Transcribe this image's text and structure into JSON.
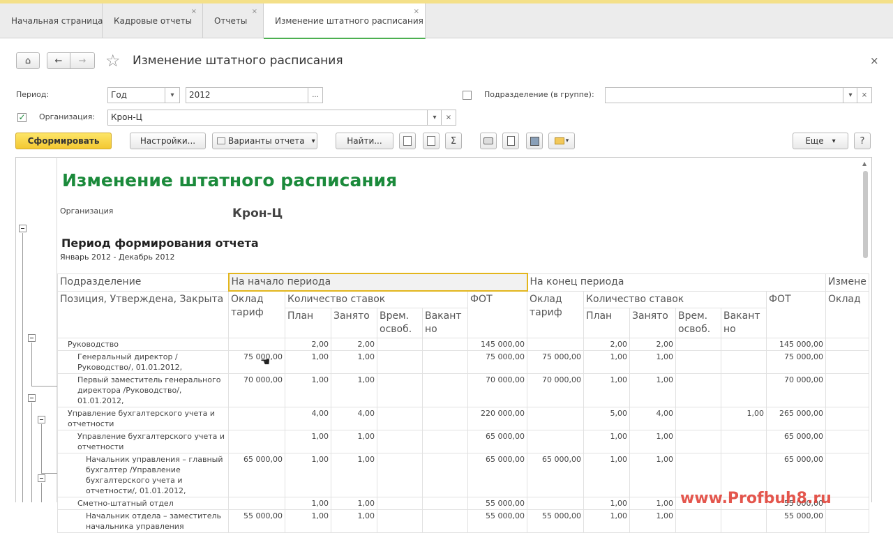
{
  "tabs": [
    {
      "label": "Начальная страница",
      "close": ""
    },
    {
      "label": "Кадровые отчеты",
      "close": "×"
    },
    {
      "label": "Отчеты",
      "close": "×"
    },
    {
      "label": "Изменение штатного расписания",
      "close": "×"
    }
  ],
  "window": {
    "title": "Изменение штатного расписания",
    "close": "×",
    "home_icon": "⌂",
    "back_icon": "←",
    "forward_icon": "→",
    "favorite_icon": "☆"
  },
  "form": {
    "period_label": "Период:",
    "period_type": "Год",
    "period_value": "2012",
    "period_select": "...",
    "subdivision_label": "Подразделение (в группе):",
    "subdivision_value": "",
    "org_label": "Организация:",
    "org_value": "Крон-Ц",
    "org_checked": "✓",
    "dropdown": "▾",
    "clear": "×"
  },
  "toolbar": {
    "generate": "Сформировать",
    "settings": "Настройки...",
    "variants": "Варианты отчета",
    "find": "Найти...",
    "sum_icon": "Σ",
    "more": "Еще",
    "help": "?"
  },
  "report": {
    "title": "Изменение штатного расписания",
    "org_label": "Организация",
    "org_value": "Крон-Ц",
    "period_header": "Период формирования отчета",
    "period_value": "Январь 2012 - Декабрь 2012",
    "col_subdivision": "Подразделение",
    "col_position": "Позиция, Утверждена, Закрыта",
    "group_start": "На начало периода",
    "group_end": "На конец периода",
    "group_change": "Измене",
    "salary": "Оклад тариф",
    "salary_cut": "Оклад",
    "rates": "Количество ставок",
    "plan": "План",
    "occupied": "Занято",
    "temp_free": "Врем. освоб.",
    "vacant": "Вакант но",
    "fot": "ФОТ",
    "rows": [
      {
        "name": "Руководство",
        "s1": "",
        "p1": "2,00",
        "o1": "2,00",
        "t1": "",
        "v1": "",
        "f1": "145 000,00",
        "s2": "",
        "p2": "2,00",
        "o2": "2,00",
        "t2": "",
        "v2": "",
        "f2": "145 000,00"
      },
      {
        "name": "Генеральный директор /Руководство/, 01.01.2012,",
        "s1": "75 000,00",
        "p1": "1,00",
        "o1": "1,00",
        "t1": "",
        "v1": "",
        "f1": "75 000,00",
        "s2": "75 000,00",
        "p2": "1,00",
        "o2": "1,00",
        "t2": "",
        "v2": "",
        "f2": "75 000,00"
      },
      {
        "name": "Первый заместитель генерального директора /Руководство/, 01.01.2012,",
        "s1": "70 000,00",
        "p1": "1,00",
        "o1": "1,00",
        "t1": "",
        "v1": "",
        "f1": "70 000,00",
        "s2": "70 000,00",
        "p2": "1,00",
        "o2": "1,00",
        "t2": "",
        "v2": "",
        "f2": "70 000,00"
      },
      {
        "name": "Управление бухгалтерского учета и отчетности",
        "s1": "",
        "p1": "4,00",
        "o1": "4,00",
        "t1": "",
        "v1": "",
        "f1": "220 000,00",
        "s2": "",
        "p2": "5,00",
        "o2": "4,00",
        "t2": "",
        "v2": "1,00",
        "f2": "265 000,00"
      },
      {
        "name": "Управление бухгалтерского учета и отчетности",
        "s1": "",
        "p1": "1,00",
        "o1": "1,00",
        "t1": "",
        "v1": "",
        "f1": "65 000,00",
        "s2": "",
        "p2": "1,00",
        "o2": "1,00",
        "t2": "",
        "v2": "",
        "f2": "65 000,00"
      },
      {
        "name": "Начальник управления – главный бухгалтер /Управление бухгалтерского учета и отчетности/, 01.01.2012,",
        "s1": "65 000,00",
        "p1": "1,00",
        "o1": "1,00",
        "t1": "",
        "v1": "",
        "f1": "65 000,00",
        "s2": "65 000,00",
        "p2": "1,00",
        "o2": "1,00",
        "t2": "",
        "v2": "",
        "f2": "65 000,00"
      },
      {
        "name": "Сметно-штатный отдел",
        "s1": "",
        "p1": "1,00",
        "o1": "1,00",
        "t1": "",
        "v1": "",
        "f1": "55 000,00",
        "s2": "",
        "p2": "1,00",
        "o2": "1,00",
        "t2": "",
        "v2": "",
        "f2": "55 000,00"
      },
      {
        "name": "Начальник отдела – заместитель начальника управления",
        "s1": "55 000,00",
        "p1": "1,00",
        "o1": "1,00",
        "t1": "",
        "v1": "",
        "f1": "55 000,00",
        "s2": "55 000,00",
        "p2": "1,00",
        "o2": "1,00",
        "t2": "",
        "v2": "",
        "f2": "55 000,00"
      }
    ]
  },
  "watermark": "www.Profbuh8.ru"
}
